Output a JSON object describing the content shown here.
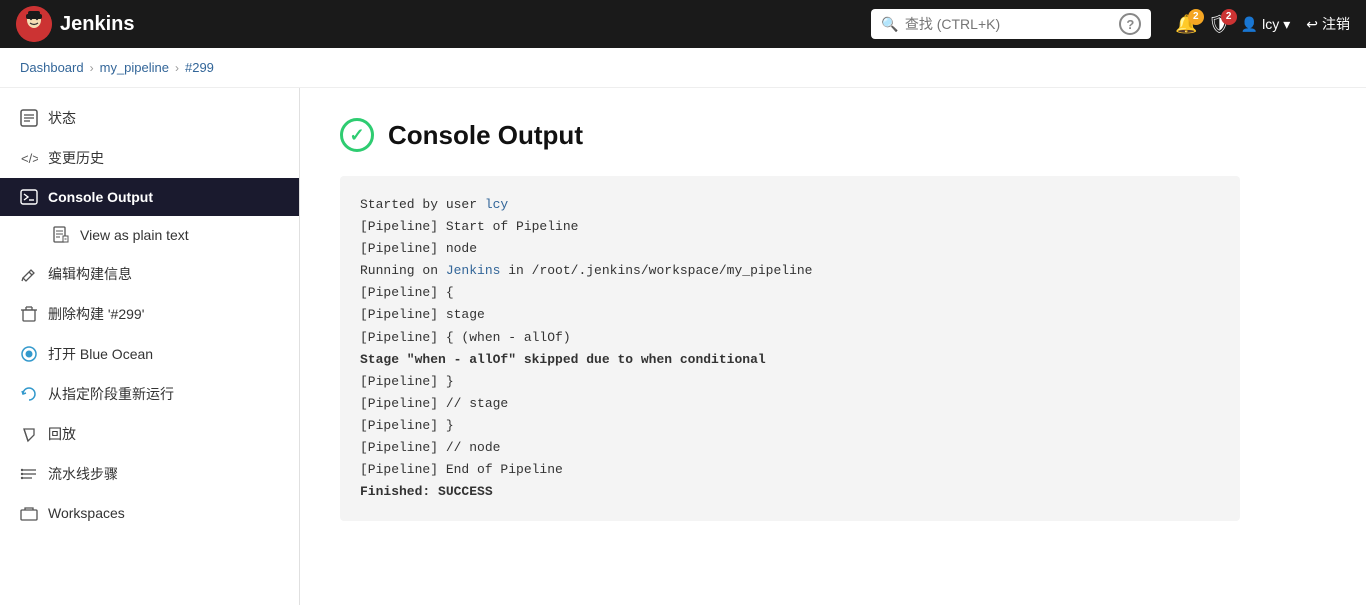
{
  "header": {
    "logo_text": "Jenkins",
    "search_placeholder": "查找 (CTRL+K)",
    "help_label": "?",
    "notifications_count": "2",
    "security_count": "2",
    "user_name": "lcy",
    "logout_label": "注销"
  },
  "breadcrumb": {
    "items": [
      {
        "label": "Dashboard",
        "href": "#"
      },
      {
        "label": "my_pipeline",
        "href": "#"
      },
      {
        "label": "#299",
        "href": "#"
      }
    ]
  },
  "sidebar": {
    "items": [
      {
        "id": "status",
        "label": "状态",
        "icon": "📋",
        "active": false
      },
      {
        "id": "changes",
        "label": "变更历史",
        "icon": "</>",
        "active": false
      },
      {
        "id": "console",
        "label": "Console Output",
        "icon": ">_",
        "active": true
      },
      {
        "id": "plain-text",
        "label": "View as plain text",
        "icon": "📄",
        "active": false,
        "sub": true
      },
      {
        "id": "edit-build",
        "label": "编辑构建信息",
        "icon": "✎",
        "active": false
      },
      {
        "id": "delete-build",
        "label": "删除构建 '#299'",
        "icon": "🗑",
        "active": false
      },
      {
        "id": "blue-ocean",
        "label": "打开 Blue Ocean",
        "icon": "◎",
        "active": false
      },
      {
        "id": "restart-stage",
        "label": "从指定阶段重新运行",
        "icon": "↻",
        "active": false
      },
      {
        "id": "replay",
        "label": "回放",
        "icon": "↗",
        "active": false
      },
      {
        "id": "pipeline-steps",
        "label": "流水线步骤",
        "icon": "≡",
        "active": false
      },
      {
        "id": "workspaces",
        "label": "Workspaces",
        "icon": "📁",
        "active": false
      }
    ]
  },
  "main": {
    "title": "Console Output",
    "console_lines": [
      {
        "text": "Started by user ",
        "link": null,
        "bold": false
      },
      {
        "text": "[Pipeline] Start of Pipeline",
        "link": null,
        "bold": false
      },
      {
        "text": "[Pipeline] node",
        "link": null,
        "bold": false
      },
      {
        "text": "Running on Jenkins in /root/.jenkins/workspace/my_pipeline",
        "link": "Jenkins",
        "bold": false
      },
      {
        "text": "[Pipeline] {",
        "link": null,
        "bold": false
      },
      {
        "text": "[Pipeline] stage",
        "link": null,
        "bold": false
      },
      {
        "text": "[Pipeline] { (when - allOf)",
        "link": null,
        "bold": false
      },
      {
        "text": "Stage \"when - allOf\" skipped due to when conditional",
        "link": null,
        "bold": true
      },
      {
        "text": "[Pipeline] }",
        "link": null,
        "bold": false
      },
      {
        "text": "[Pipeline] // stage",
        "link": null,
        "bold": false
      },
      {
        "text": "[Pipeline] }",
        "link": null,
        "bold": false
      },
      {
        "text": "[Pipeline] // node",
        "link": null,
        "bold": false
      },
      {
        "text": "[Pipeline] End of Pipeline",
        "link": null,
        "bold": false
      },
      {
        "text": "Finished: SUCCESS",
        "link": null,
        "bold": true
      }
    ],
    "user_link_text": "lcy",
    "jenkins_link_text": "Jenkins"
  }
}
